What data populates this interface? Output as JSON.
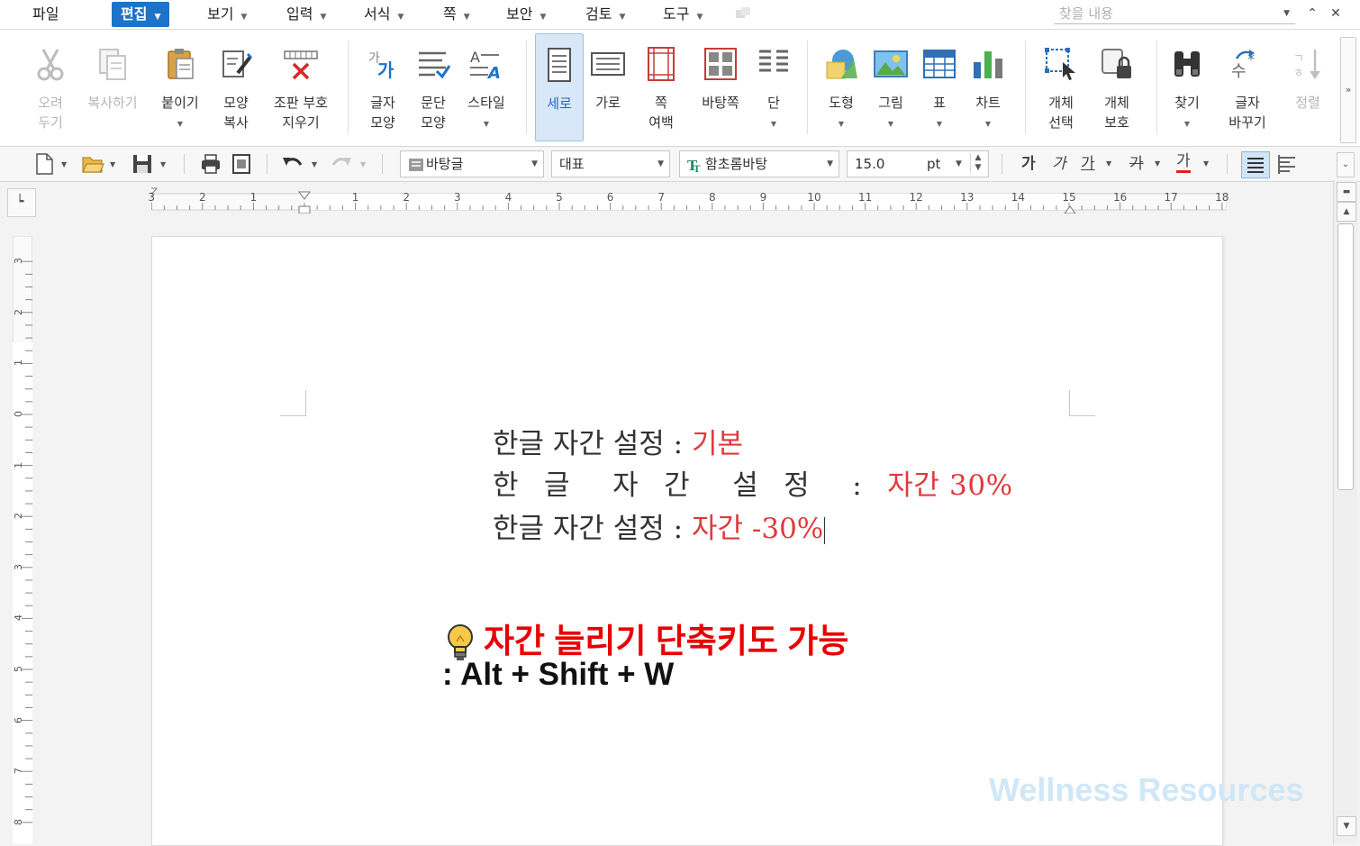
{
  "menu": {
    "file": "파일",
    "edit": "편집",
    "view": "보기",
    "input": "입력",
    "format": "서식",
    "page": "쪽",
    "security": "보안",
    "review": "검토",
    "tools": "도구",
    "search_placeholder": "찾을 내용"
  },
  "ribbon": {
    "cut": "오려\n두기",
    "copy": "복사하기",
    "paste": "붙이기",
    "format_copy": "모양\n복사",
    "clear_marks": "조판 부호\n지우기",
    "char_shape": "글자\n모양",
    "para_shape": "문단\n모양",
    "style": "스타일",
    "portrait": "세로",
    "landscape": "가로",
    "page_margin": "쪽\n여백",
    "master_page": "바탕쪽",
    "columns": "단",
    "shape": "도형",
    "picture": "그림",
    "table": "표",
    "chart": "차트",
    "select_object": "개체\n선택",
    "protect_object": "개체\n보호",
    "find": "찾기",
    "replace": "글자\n바꾸기",
    "sort": "정렬"
  },
  "toolbar": {
    "style_value": "바탕글",
    "lang_value": "대표",
    "font_value": "함초롬바탕",
    "size_value": "15.0",
    "size_unit": "pt",
    "bold": "가",
    "italic": "가",
    "underline": "가",
    "strike": "가",
    "font_color": "가"
  },
  "ruler": {
    "h_ticks": [
      "3",
      "2",
      "1",
      "1",
      "2",
      "3",
      "4",
      "5",
      "6",
      "7",
      "8",
      "9",
      "10",
      "11",
      "12",
      "13",
      "14",
      "15",
      "16",
      "17",
      "18"
    ],
    "v_ticks": [
      "3",
      "2",
      "1",
      "0",
      "1",
      "2",
      "3",
      "4",
      "5",
      "6",
      "7",
      "8"
    ]
  },
  "document": {
    "line1_label": "한글 자간 설정 : ",
    "line1_value": "기본",
    "line2_label": "한 글  자 간  설 정  : ",
    "line2_value": "자간 30%",
    "line3_label": "한글 자간 설정 : ",
    "line3_value": "자간 -30%",
    "tip_title": "자간 늘리기 단축키도 가능",
    "tip_shortcut": ": Alt + Shift + W"
  },
  "watermark": "Wellness Resources",
  "colors": {
    "accent": "#1e73c8",
    "red_text": "#e0393c",
    "tip_red": "#e80000"
  }
}
